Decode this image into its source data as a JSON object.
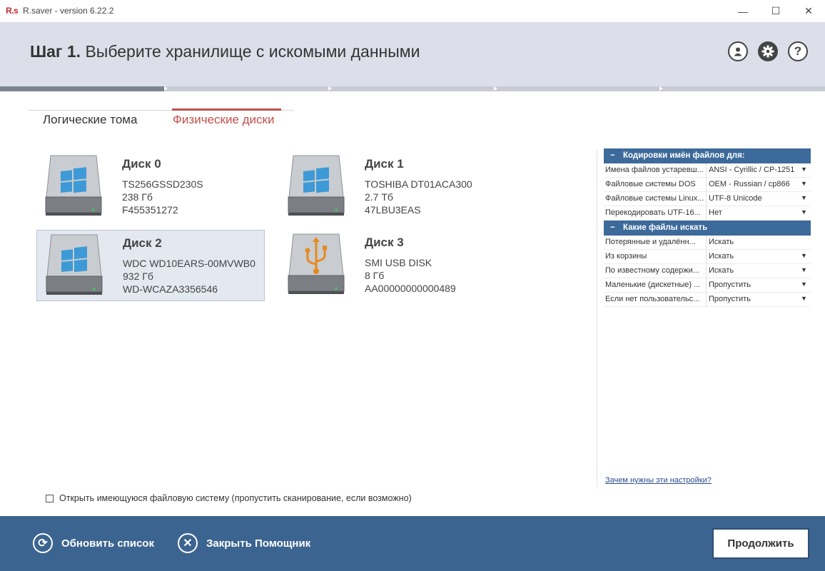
{
  "window": {
    "logo": "R.s",
    "title": "R.saver - version 6.22.2",
    "min_glyph": "—",
    "max_glyph": "☐",
    "close_glyph": "✕"
  },
  "header": {
    "step": "Шаг 1.",
    "title": "Выберите хранилище с искомыми данными",
    "icons": [
      "user-icon",
      "gear-icon",
      "help-icon"
    ],
    "progress_fraction": 0.2
  },
  "tabs": [
    {
      "label": "Логические тома",
      "active": false
    },
    {
      "label": "Физические диски",
      "active": true
    }
  ],
  "disks": [
    {
      "name": "Диск 0",
      "model": "TS256GSSD230S",
      "size": "238 Гб",
      "serial": "F455351272",
      "icon": "windows",
      "selected": false
    },
    {
      "name": "Диск 1",
      "model": "TOSHIBA DT01ACA300",
      "size": "2.7 Тб",
      "serial": "47LBU3EAS",
      "icon": "windows",
      "selected": false
    },
    {
      "name": "Диск 2",
      "model": "WDC WD10EARS-00MVWB0",
      "size": "932 Гб",
      "serial": "WD-WCAZA3356546",
      "icon": "windows",
      "selected": true
    },
    {
      "name": "Диск 3",
      "model": "SMI USB DISK",
      "size": "8 Гб",
      "serial": "AA00000000000489",
      "icon": "usb",
      "selected": false
    }
  ],
  "settings": {
    "group1": "Кодировки имён файлов для:",
    "group1_rows": [
      {
        "key": "Имена файлов устаревш...",
        "value": "ANSI - Cyrillic / CP-1251"
      },
      {
        "key": "Файловые системы DOS",
        "value": "OEM - Russian / cp866"
      },
      {
        "key": "Файловые системы Linux...",
        "value": "UTF-8 Unicode"
      },
      {
        "key": "Перекодировать UTF-16...",
        "value": "Нет"
      }
    ],
    "group2": "Какие файлы искать",
    "group2_rows": [
      {
        "key": "Потерянные и удалённ...",
        "value": "Искать",
        "dropdown": false
      },
      {
        "key": "Из корзины",
        "value": "Искать",
        "dropdown": true
      },
      {
        "key": "По известному содержи...",
        "value": "Искать",
        "dropdown": true
      },
      {
        "key": "Маленькие (дискетные) ...",
        "value": "Пропустить",
        "dropdown": true
      },
      {
        "key": "Если нет пользовательс...",
        "value": "Пропустить",
        "dropdown": true
      }
    ],
    "collapse_glyph": "−",
    "dropdown_glyph": "▼",
    "help_link": "Зачем нужны эти настройки?"
  },
  "checkbox_label": "Открыть имеющуюся файловую систему (пропустить сканирование, если возможно)",
  "checkbox_checked": false,
  "footer": {
    "refresh": "Обновить список",
    "close": "Закрыть Помощник",
    "continue": "Продолжить"
  },
  "colors": {
    "accent_red": "#c0504d",
    "panel_blue": "#3c6a9a",
    "footer_blue": "#3c6490",
    "header_bg": "#dcdfe9"
  }
}
